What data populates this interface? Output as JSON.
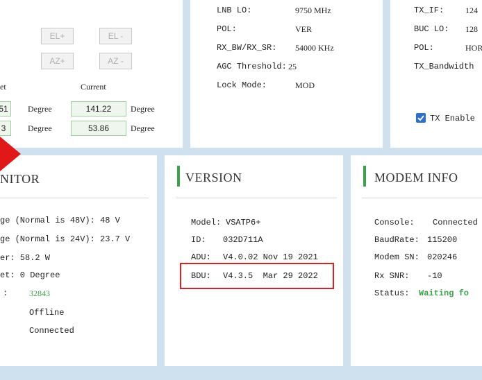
{
  "antenna": {
    "buttons": {
      "el_plus": "EL+",
      "el_minus": "EL -",
      "az_plus": "AZ+",
      "az_minus": "AZ -"
    },
    "col_target": "et",
    "col_current": "Current",
    "row1": {
      "target": "51",
      "unit": "Degree",
      "current": "141.22",
      "unit2": "Degree"
    },
    "row2": {
      "target": "3",
      "unit": "Degree",
      "current": "53.86",
      "unit2": "Degree"
    }
  },
  "rx": {
    "lnb_lo_label": "LNB LO:",
    "lnb_lo_value": "9750 MHz",
    "pol_label": "POL:",
    "pol_value": "VER",
    "bw_label": "RX_BW/RX_SR:",
    "bw_value": "54000 KHz",
    "agc_label": "AGC Threshold:",
    "agc_value": "25",
    "lock_label": "Lock Mode:",
    "lock_value": "MOD"
  },
  "tx": {
    "tx_if_label": "TX_IF:",
    "tx_if_value": "124",
    "buc_lo_label": "BUC LO:",
    "buc_lo_value": "128",
    "pol_label": "POL:",
    "pol_value": "HOR",
    "bw_label": "TX_Bandwidth",
    "enable_label": "TX Enable",
    "enable_checked": true
  },
  "monitor": {
    "title": "NITOR",
    "lines": [
      "ge (Normal is 48V): 48 V",
      "ge (Normal is 24V): 23.7 V",
      "er: 58.2 W",
      "et: 0 Degree"
    ],
    "colon": ":",
    "value_green": "32843",
    "offline": "Offline",
    "connected": "Connected"
  },
  "version": {
    "title": "VERSION",
    "model_label": "Model:",
    "model_value": "VSATP6+",
    "id_label": "ID:",
    "id_value": "032D711A",
    "adu_label": "ADU:",
    "adu_value": "V4.0.02 Nov 19 2021",
    "bdu_label": "BDU:",
    "bdu_value": "V4.3.5  Mar 29 2022"
  },
  "modem": {
    "title": "MODEM INFO",
    "console_label": "Console:",
    "console_value": "Connected",
    "baud_label": "BaudRate:",
    "baud_value": "115200",
    "sn_label": "Modem SN:",
    "sn_value": "020246",
    "snr_label": "Rx SNR:",
    "snr_value": "-10",
    "status_label": "Status:",
    "status_value": "Waiting fo"
  },
  "colors": {
    "accent": "#3aa24a",
    "highlight_box": "#e02020",
    "arrow": "#e01818",
    "page_bg": "#cfe0ef"
  }
}
